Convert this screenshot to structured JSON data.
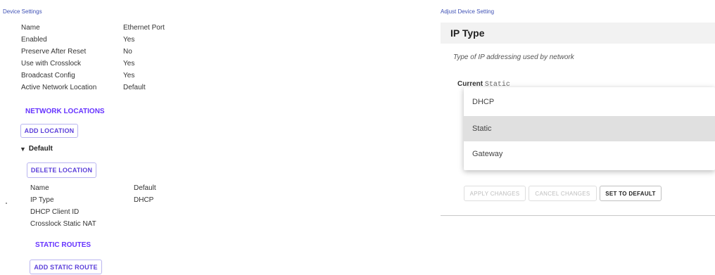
{
  "left": {
    "section_title": "Device Settings",
    "device_settings": [
      {
        "label": "Name",
        "value": "Ethernet Port"
      },
      {
        "label": "Enabled",
        "value": "Yes"
      },
      {
        "label": "Preserve After Reset",
        "value": "No"
      },
      {
        "label": "Use with Crosslock",
        "value": "Yes"
      },
      {
        "label": "Broadcast Config",
        "value": "Yes"
      },
      {
        "label": "Active Network Location",
        "value": "Default"
      }
    ],
    "network_locations_heading": "NETWORK LOCATIONS",
    "add_location_label": "ADD LOCATION",
    "tree_node_label": "Default",
    "tree_toggle_icon": "triangle-down-icon",
    "delete_location_label": "DELETE LOCATION",
    "location_settings": [
      {
        "label": "Name",
        "value": "Default"
      },
      {
        "label": "IP Type",
        "value": "DHCP"
      },
      {
        "label": "DHCP Client ID",
        "value": ""
      },
      {
        "label": "Crosslock Static NAT",
        "value": ""
      }
    ],
    "static_routes_heading": "STATIC ROUTES",
    "add_static_route_label": "ADD STATIC ROUTE"
  },
  "right": {
    "section_title": "Adjust Device Setting",
    "setting_name": "IP Type",
    "description": "Type of IP addressing used by network",
    "current_label": "Current",
    "current_value": "Static",
    "options": [
      "DHCP",
      "Static",
      "Gateway"
    ],
    "selected_option": "Static",
    "apply_label": "APPLY CHANGES",
    "cancel_label": "CANCEL CHANGES",
    "default_label": "SET TO DEFAULT"
  },
  "colors": {
    "accent": "#6633ff",
    "section_title": "#3f51b5",
    "selected_option_bg": "#e0e0e0"
  }
}
